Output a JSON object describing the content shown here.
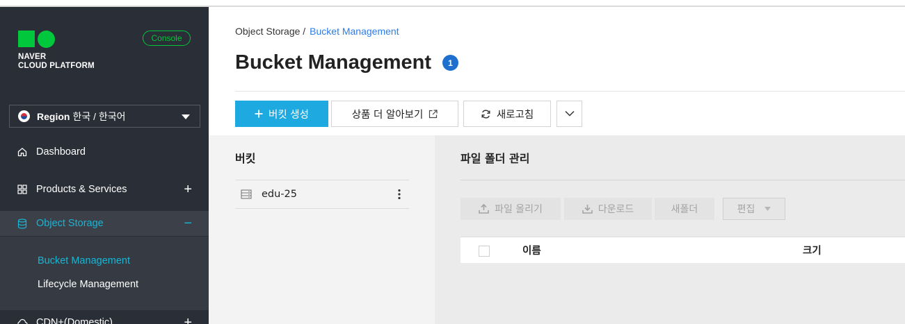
{
  "app": {
    "brand_line1": "NAVER",
    "brand_line2": "CLOUD PLATFORM",
    "console_label": "Console"
  },
  "region": {
    "label": "Region",
    "value": "한국 / 한국어"
  },
  "sidebar": {
    "items": [
      {
        "label": "Dashboard",
        "icon": "home-icon"
      },
      {
        "label": "Products & Services",
        "icon": "grid-icon",
        "toggle": "+"
      },
      {
        "label": "Object Storage",
        "icon": "database-icon",
        "toggle": "−",
        "active": true
      },
      {
        "label": "CDN+(Domestic)",
        "icon": "cloud-icon",
        "toggle": "+"
      }
    ],
    "subitems": [
      {
        "label": "Bucket Management",
        "active": true
      },
      {
        "label": "Lifecycle Management"
      }
    ]
  },
  "breadcrumb": {
    "root": "Object Storage /",
    "current": "Bucket Management"
  },
  "page": {
    "title": "Bucket Management",
    "help_badge": "1"
  },
  "toolbar": {
    "create_label": "버킷 생성",
    "learn_more_label": "상품 더 알아보기",
    "refresh_label": "새로고침"
  },
  "buckets": {
    "title": "버킷",
    "items": [
      "edu-25"
    ]
  },
  "files": {
    "title": "파일 폴더 관리",
    "upload_label": "파일 올리기",
    "download_label": "다운로드",
    "new_folder_label": "새폴더",
    "edit_label": "편집",
    "col_name": "이름",
    "col_size": "크기"
  },
  "colors": {
    "sidebar_bg": "#2a2e36",
    "accent": "#1fa9e1",
    "active_text": "#19b5d4",
    "brand_green": "#00c73c",
    "help_blue": "#1f6fce"
  }
}
